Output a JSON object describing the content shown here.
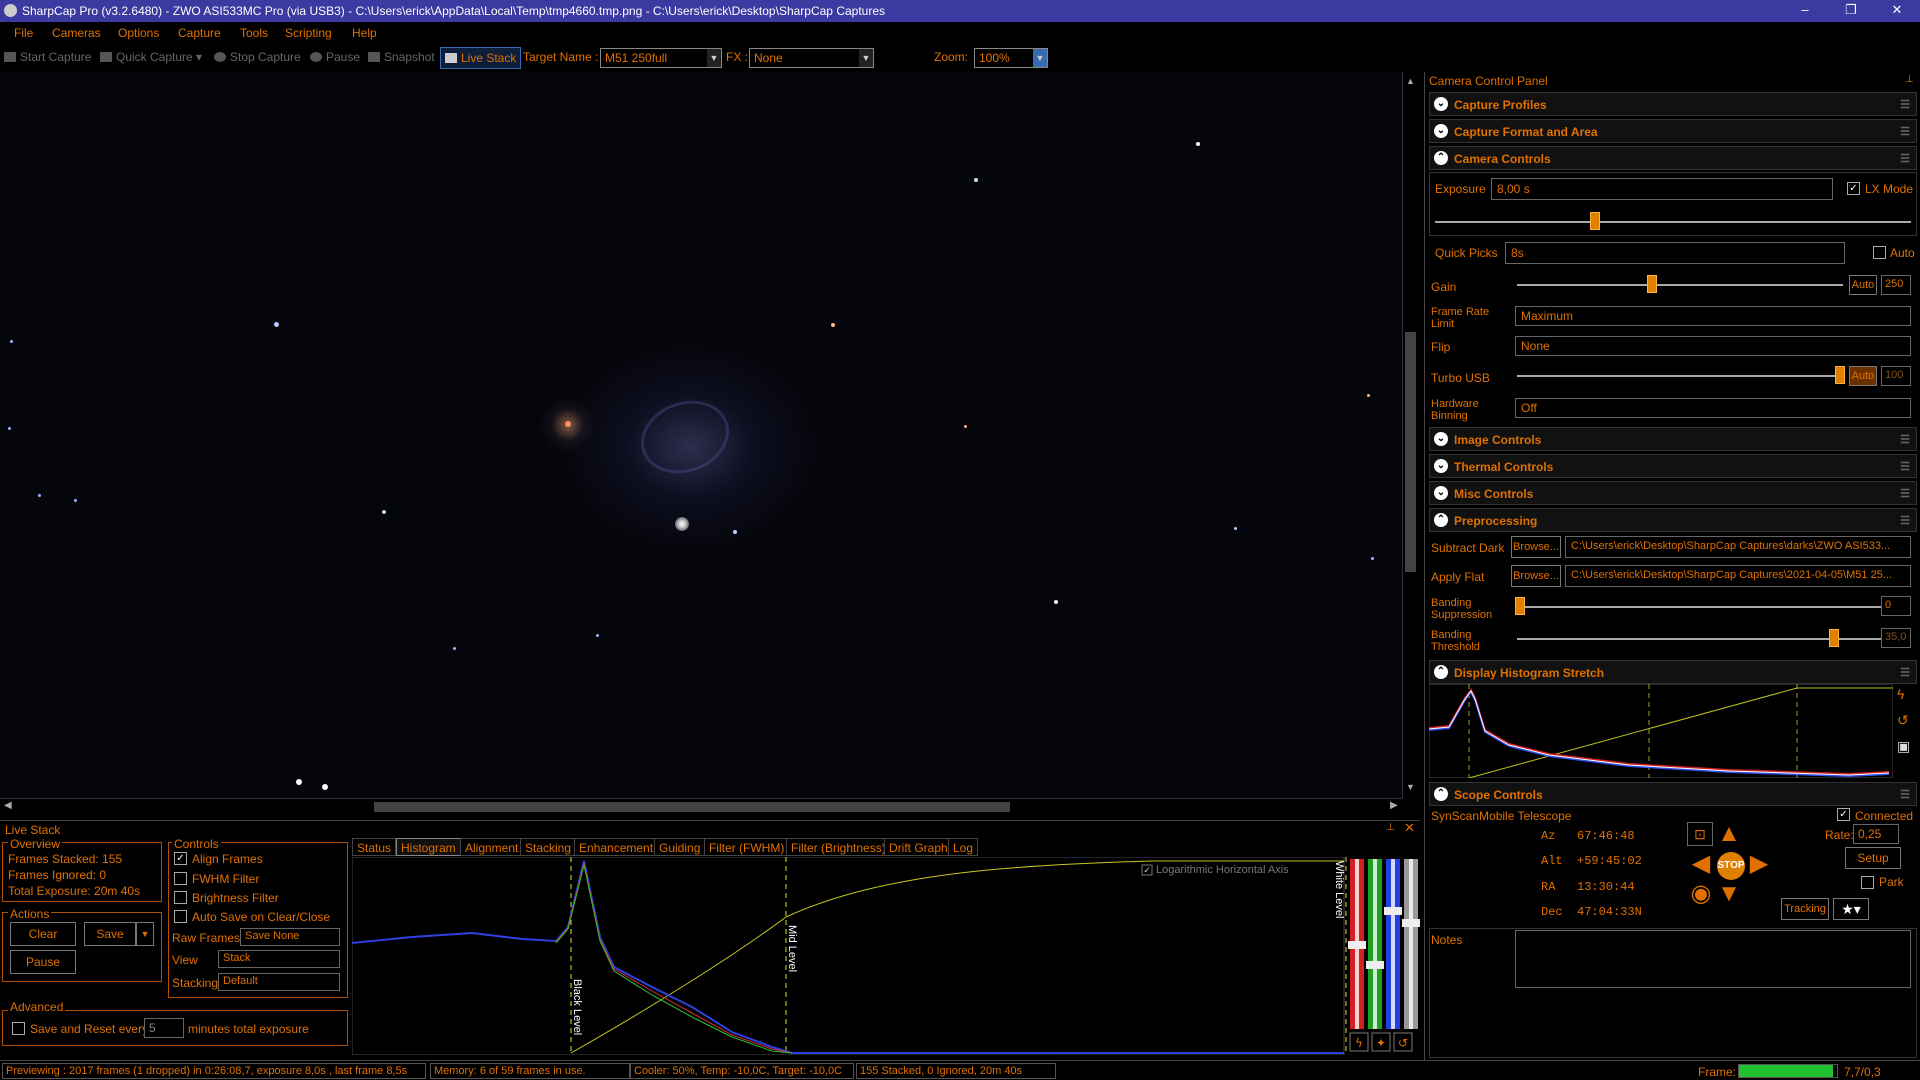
{
  "window": {
    "title": "SharpCap Pro (v3.2.6480) - ZWO ASI533MC Pro (via USB3) - C:\\Users\\erick\\AppData\\Local\\Temp\\tmp4660.tmp.png - C:\\Users\\erick\\Desktop\\SharpCap Captures",
    "minimize": "–",
    "maximize": "❐",
    "close": "✕"
  },
  "menu": [
    "File",
    "Cameras",
    "Options",
    "Capture",
    "Tools",
    "Scripting",
    "Help"
  ],
  "toolbar": {
    "start_capture": "Start Capture",
    "quick_capture": "Quick Capture",
    "stop_capture": "Stop Capture",
    "pause": "Pause",
    "snapshot": "Snapshot",
    "live_stack": "Live Stack",
    "target_label": "Target Name :",
    "target_value": "M51 250full",
    "fx_label": "FX :",
    "fx_value": "None",
    "zoom_label": "Zoom:",
    "zoom_value": "100%"
  },
  "panel": {
    "title": "Camera Control Panel",
    "sections": {
      "capture_profiles": "Capture Profiles",
      "capture_format": "Capture Format and Area",
      "camera_controls": "Camera Controls",
      "image_controls": "Image Controls",
      "thermal_controls": "Thermal Controls",
      "misc_controls": "Misc Controls",
      "preprocessing": "Preprocessing",
      "histogram": "Display Histogram Stretch",
      "scope": "Scope Controls"
    },
    "exposure_label": "Exposure",
    "exposure_value": "8,00 s",
    "lx_mode": "LX Mode",
    "quick_picks_label": "Quick Picks",
    "quick_picks_value": "8s",
    "auto": "Auto",
    "gain_label": "Gain",
    "gain_auto": "Auto",
    "gain_value": "250",
    "frame_rate_label": "Frame Rate Limit",
    "frame_rate_value": "Maximum",
    "flip_label": "Flip",
    "flip_value": "None",
    "turbo_label": "Turbo USB",
    "turbo_auto": "Auto",
    "turbo_value": "100",
    "binning_label": "Hardware Binning",
    "binning_value": "Off",
    "subtract_dark_label": "Subtract Dark",
    "browse": "Browse...",
    "dark_path": "C:\\Users\\erick\\Desktop\\SharpCap Captures\\darks\\ZWO ASI533...",
    "apply_flat_label": "Apply Flat",
    "flat_path": "C:\\Users\\erick\\Desktop\\SharpCap Captures\\2021-04-05\\M51 25...",
    "banding_supp_label": "Banding Suppression",
    "banding_supp_value": "0",
    "banding_thr_label": "Banding Threshold",
    "banding_thr_value": "35,0",
    "scope_name": "SynScanMobile Telescope",
    "connected": "Connected",
    "rate_label": "Rate:",
    "rate_value": "0,25",
    "setup": "Setup",
    "park": "Park",
    "tracking": "Tracking",
    "stop": "STOP",
    "az": "Az   67:46:48",
    "alt": "Alt  +59:45:02",
    "ra": "RA   13:30:44",
    "dec": "Dec  47:04:33N",
    "notes_label": "Notes"
  },
  "livestack": {
    "title": "Live Stack",
    "overview": "Overview",
    "frames_stacked": "Frames Stacked:  155",
    "frames_ignored": "Frames Ignored:   0",
    "total_exposure": "Total Exposure:   20m 40s",
    "actions": "Actions",
    "clear": "Clear",
    "save": "Save",
    "pause": "Pause",
    "controls": "Controls",
    "align_frames": "Align Frames",
    "fwhm_filter": "FWHM Filter",
    "brightness_filter": "Brightness Filter",
    "auto_save": "Auto Save on Clear/Close",
    "raw_frames_label": "Raw Frames",
    "raw_frames_value": "Save None",
    "view_label": "View",
    "view_value": "Stack",
    "stacking_label": "Stacking",
    "stacking_value": "Default",
    "advanced": "Advanced",
    "save_reset": "Save and Reset every",
    "minutes_value": "5",
    "minutes_label": "minutes total exposure",
    "tabs": [
      "Status",
      "Histogram",
      "Alignment",
      "Stacking",
      "Enhancement",
      "Guiding",
      "Filter (FWHM)",
      "Filter (Brightness)",
      "Drift Graph",
      "Log"
    ],
    "log_axis": "Logarithmic Horizontal Axis",
    "black_level": "Black Level",
    "mid_level": "Mid Level",
    "white_level": "White Level"
  },
  "status": {
    "preview": "Previewing : 2017 frames (1 dropped) in 0:26:08,7, exposure 8,0s , last frame 8,5s",
    "memory": "Memory: 6 of 59 frames in use.",
    "cooler": "Cooler: 50%, Temp: -10,0C, Target: -10,0C",
    "stacked": "155 Stacked, 0 Ignored, 20m 40s",
    "frame_label": "Frame:",
    "frame_value": "7,7/0,3",
    "frame_progress": 0.96
  }
}
